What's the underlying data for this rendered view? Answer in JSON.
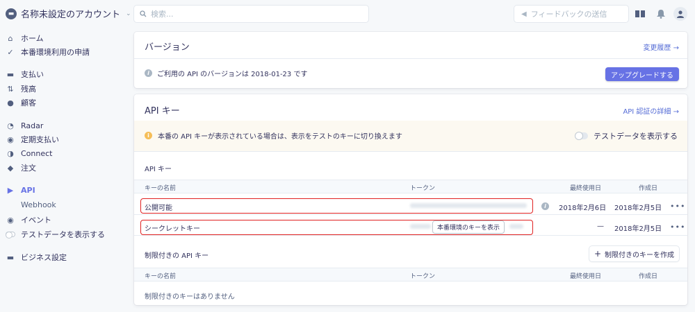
{
  "account": {
    "name": "名称未設定のアカウント",
    "logo_icon": "store-icon",
    "chevron": "⌄"
  },
  "search": {
    "placeholder": "検索..."
  },
  "feedback": {
    "label": "フィードバックの送信"
  },
  "sidebar": {
    "items": [
      {
        "label": "ホーム",
        "icon": "home-icon"
      },
      {
        "label": "本番環境利用の申請",
        "icon": "check-icon"
      },
      {
        "label": "支払い",
        "icon": "payments-icon"
      },
      {
        "label": "残高",
        "icon": "balance-icon"
      },
      {
        "label": "顧客",
        "icon": "customers-icon"
      },
      {
        "label": "Radar",
        "icon": "radar-icon"
      },
      {
        "label": "定期支払い",
        "icon": "subscriptions-icon"
      },
      {
        "label": "Connect",
        "icon": "connect-icon"
      },
      {
        "label": "注文",
        "icon": "orders-icon"
      },
      {
        "label": "API",
        "icon": "api-icon"
      },
      {
        "label": "Webhook"
      },
      {
        "label": "イベント",
        "icon": "events-icon"
      },
      {
        "label": "テストデータを表示する"
      },
      {
        "label": "ビジネス設定",
        "icon": "business-settings-icon"
      }
    ]
  },
  "version_card": {
    "title": "バージョン",
    "link": "変更履歴 →",
    "info": "ご利用の API のバージョンは 2018-01-23 です",
    "upgrade_button": "アップグレードする"
  },
  "api_card": {
    "title": "API キー",
    "link": "API 認証の詳細 →",
    "notice": "本番の API キーが表示されている場合は、表示をテストのキーに切り換えます",
    "toggle_label": "テストデータを表示する",
    "section_title": "API キー",
    "columns": [
      "キーの名前",
      "トークン",
      "最終使用日",
      "作成日"
    ],
    "rows": [
      {
        "name": "公開可能",
        "last_used": "2018年2月6日",
        "created": "2018年2月5日",
        "more": "•••"
      },
      {
        "name": "シークレットキー",
        "reveal": "本番環境のキーを表示",
        "last_used": "—",
        "created": "2018年2月5日",
        "more": "•••"
      }
    ],
    "restricted_title": "制限付きの API キー",
    "create_button": "制限付きのキーを作成",
    "restricted_columns": [
      "キーの名前",
      "トークン",
      "最終使用日",
      "作成日"
    ],
    "empty": "制限付きのキーはありません"
  },
  "colors": {
    "accent": "#6772e5",
    "highlight": "#e02020",
    "warning": "#f5be58"
  }
}
